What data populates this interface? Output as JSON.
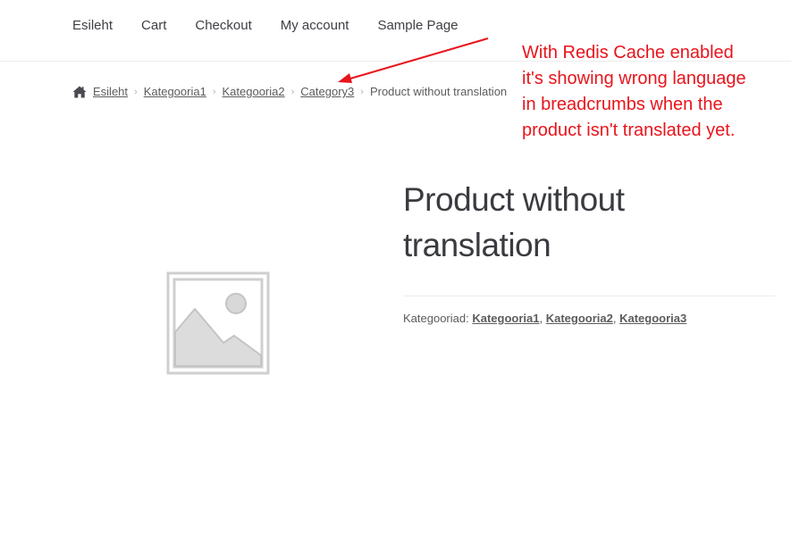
{
  "nav": {
    "items": [
      {
        "label": "Esileht"
      },
      {
        "label": "Cart"
      },
      {
        "label": "Checkout"
      },
      {
        "label": "My account"
      },
      {
        "label": "Sample Page"
      }
    ]
  },
  "breadcrumb": {
    "home_icon": "home-icon",
    "items": [
      {
        "label": "Esileht"
      },
      {
        "label": "Kategooria1"
      },
      {
        "label": "Kategooria2"
      },
      {
        "label": "Category3"
      }
    ],
    "current": "Product without translation",
    "separator": "›"
  },
  "annotation": {
    "lines": [
      "With Redis Cache enabled",
      "it's showing wrong language",
      "in breadcrumbs when the",
      "product isn't translated yet."
    ],
    "color": "#e8141c"
  },
  "product": {
    "title_line1": "Product without",
    "title_line2": "translation",
    "image_icon": "image-placeholder-icon",
    "categories_label": "Kategooriad:",
    "categories": [
      "Kategooria1",
      "Kategooria2",
      "Kategooria3"
    ],
    "category_separator": ", "
  }
}
